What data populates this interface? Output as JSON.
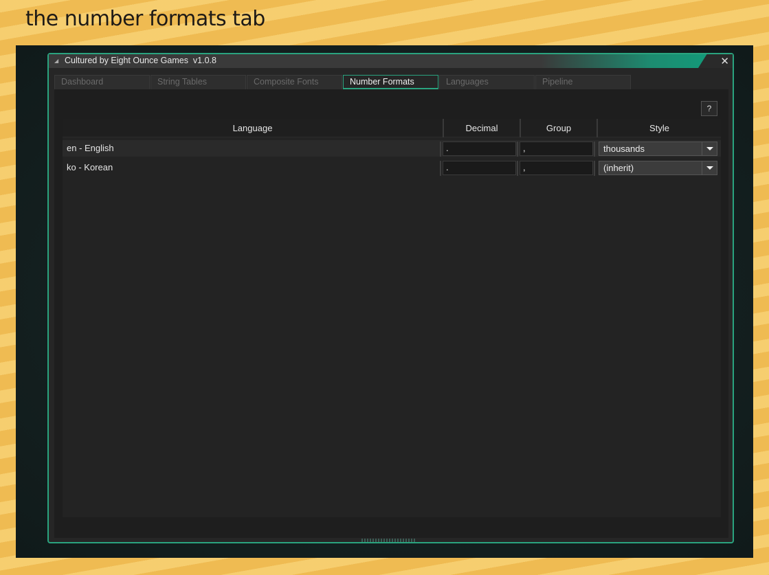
{
  "slide": {
    "heading": "the number formats tab"
  },
  "window": {
    "title": "Cultured by Eight Ounce Games  v1.0.8",
    "close_glyph": "✕",
    "collapse_glyph": "◢"
  },
  "tabs": [
    {
      "label": "Dashboard",
      "active": false
    },
    {
      "label": "String Tables",
      "active": false
    },
    {
      "label": "Composite Fonts",
      "active": false
    },
    {
      "label": "Number Formats",
      "active": true
    },
    {
      "label": "Languages",
      "active": false
    },
    {
      "label": "Pipeline",
      "active": false
    }
  ],
  "help_button": {
    "label": "?"
  },
  "table": {
    "headers": {
      "language": "Language",
      "decimal": "Decimal",
      "group": "Group",
      "style": "Style"
    },
    "rows": [
      {
        "language": "en - English",
        "decimal": ".",
        "group": ",",
        "style": "thousands"
      },
      {
        "language": "ko - Korean",
        "decimal": ".",
        "group": ",",
        "style": "(inherit)"
      }
    ]
  },
  "colors": {
    "accent": "#2aa47f",
    "panel": "#1e1e1e",
    "background": "#f2c15a"
  }
}
